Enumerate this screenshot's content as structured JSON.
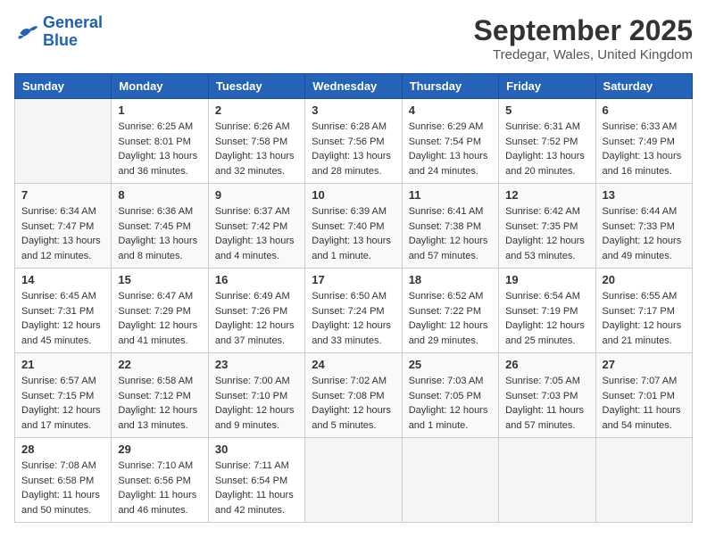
{
  "logo": {
    "line1": "General",
    "line2": "Blue"
  },
  "title": "September 2025",
  "location": "Tredegar, Wales, United Kingdom",
  "days_of_week": [
    "Sunday",
    "Monday",
    "Tuesday",
    "Wednesday",
    "Thursday",
    "Friday",
    "Saturday"
  ],
  "weeks": [
    [
      {
        "num": "",
        "sunrise": "",
        "sunset": "",
        "daylight": ""
      },
      {
        "num": "1",
        "sunrise": "Sunrise: 6:25 AM",
        "sunset": "Sunset: 8:01 PM",
        "daylight": "Daylight: 13 hours and 36 minutes."
      },
      {
        "num": "2",
        "sunrise": "Sunrise: 6:26 AM",
        "sunset": "Sunset: 7:58 PM",
        "daylight": "Daylight: 13 hours and 32 minutes."
      },
      {
        "num": "3",
        "sunrise": "Sunrise: 6:28 AM",
        "sunset": "Sunset: 7:56 PM",
        "daylight": "Daylight: 13 hours and 28 minutes."
      },
      {
        "num": "4",
        "sunrise": "Sunrise: 6:29 AM",
        "sunset": "Sunset: 7:54 PM",
        "daylight": "Daylight: 13 hours and 24 minutes."
      },
      {
        "num": "5",
        "sunrise": "Sunrise: 6:31 AM",
        "sunset": "Sunset: 7:52 PM",
        "daylight": "Daylight: 13 hours and 20 minutes."
      },
      {
        "num": "6",
        "sunrise": "Sunrise: 6:33 AM",
        "sunset": "Sunset: 7:49 PM",
        "daylight": "Daylight: 13 hours and 16 minutes."
      }
    ],
    [
      {
        "num": "7",
        "sunrise": "Sunrise: 6:34 AM",
        "sunset": "Sunset: 7:47 PM",
        "daylight": "Daylight: 13 hours and 12 minutes."
      },
      {
        "num": "8",
        "sunrise": "Sunrise: 6:36 AM",
        "sunset": "Sunset: 7:45 PM",
        "daylight": "Daylight: 13 hours and 8 minutes."
      },
      {
        "num": "9",
        "sunrise": "Sunrise: 6:37 AM",
        "sunset": "Sunset: 7:42 PM",
        "daylight": "Daylight: 13 hours and 4 minutes."
      },
      {
        "num": "10",
        "sunrise": "Sunrise: 6:39 AM",
        "sunset": "Sunset: 7:40 PM",
        "daylight": "Daylight: 13 hours and 1 minute."
      },
      {
        "num": "11",
        "sunrise": "Sunrise: 6:41 AM",
        "sunset": "Sunset: 7:38 PM",
        "daylight": "Daylight: 12 hours and 57 minutes."
      },
      {
        "num": "12",
        "sunrise": "Sunrise: 6:42 AM",
        "sunset": "Sunset: 7:35 PM",
        "daylight": "Daylight: 12 hours and 53 minutes."
      },
      {
        "num": "13",
        "sunrise": "Sunrise: 6:44 AM",
        "sunset": "Sunset: 7:33 PM",
        "daylight": "Daylight: 12 hours and 49 minutes."
      }
    ],
    [
      {
        "num": "14",
        "sunrise": "Sunrise: 6:45 AM",
        "sunset": "Sunset: 7:31 PM",
        "daylight": "Daylight: 12 hours and 45 minutes."
      },
      {
        "num": "15",
        "sunrise": "Sunrise: 6:47 AM",
        "sunset": "Sunset: 7:29 PM",
        "daylight": "Daylight: 12 hours and 41 minutes."
      },
      {
        "num": "16",
        "sunrise": "Sunrise: 6:49 AM",
        "sunset": "Sunset: 7:26 PM",
        "daylight": "Daylight: 12 hours and 37 minutes."
      },
      {
        "num": "17",
        "sunrise": "Sunrise: 6:50 AM",
        "sunset": "Sunset: 7:24 PM",
        "daylight": "Daylight: 12 hours and 33 minutes."
      },
      {
        "num": "18",
        "sunrise": "Sunrise: 6:52 AM",
        "sunset": "Sunset: 7:22 PM",
        "daylight": "Daylight: 12 hours and 29 minutes."
      },
      {
        "num": "19",
        "sunrise": "Sunrise: 6:54 AM",
        "sunset": "Sunset: 7:19 PM",
        "daylight": "Daylight: 12 hours and 25 minutes."
      },
      {
        "num": "20",
        "sunrise": "Sunrise: 6:55 AM",
        "sunset": "Sunset: 7:17 PM",
        "daylight": "Daylight: 12 hours and 21 minutes."
      }
    ],
    [
      {
        "num": "21",
        "sunrise": "Sunrise: 6:57 AM",
        "sunset": "Sunset: 7:15 PM",
        "daylight": "Daylight: 12 hours and 17 minutes."
      },
      {
        "num": "22",
        "sunrise": "Sunrise: 6:58 AM",
        "sunset": "Sunset: 7:12 PM",
        "daylight": "Daylight: 12 hours and 13 minutes."
      },
      {
        "num": "23",
        "sunrise": "Sunrise: 7:00 AM",
        "sunset": "Sunset: 7:10 PM",
        "daylight": "Daylight: 12 hours and 9 minutes."
      },
      {
        "num": "24",
        "sunrise": "Sunrise: 7:02 AM",
        "sunset": "Sunset: 7:08 PM",
        "daylight": "Daylight: 12 hours and 5 minutes."
      },
      {
        "num": "25",
        "sunrise": "Sunrise: 7:03 AM",
        "sunset": "Sunset: 7:05 PM",
        "daylight": "Daylight: 12 hours and 1 minute."
      },
      {
        "num": "26",
        "sunrise": "Sunrise: 7:05 AM",
        "sunset": "Sunset: 7:03 PM",
        "daylight": "Daylight: 11 hours and 57 minutes."
      },
      {
        "num": "27",
        "sunrise": "Sunrise: 7:07 AM",
        "sunset": "Sunset: 7:01 PM",
        "daylight": "Daylight: 11 hours and 54 minutes."
      }
    ],
    [
      {
        "num": "28",
        "sunrise": "Sunrise: 7:08 AM",
        "sunset": "Sunset: 6:58 PM",
        "daylight": "Daylight: 11 hours and 50 minutes."
      },
      {
        "num": "29",
        "sunrise": "Sunrise: 7:10 AM",
        "sunset": "Sunset: 6:56 PM",
        "daylight": "Daylight: 11 hours and 46 minutes."
      },
      {
        "num": "30",
        "sunrise": "Sunrise: 7:11 AM",
        "sunset": "Sunset: 6:54 PM",
        "daylight": "Daylight: 11 hours and 42 minutes."
      },
      {
        "num": "",
        "sunrise": "",
        "sunset": "",
        "daylight": ""
      },
      {
        "num": "",
        "sunrise": "",
        "sunset": "",
        "daylight": ""
      },
      {
        "num": "",
        "sunrise": "",
        "sunset": "",
        "daylight": ""
      },
      {
        "num": "",
        "sunrise": "",
        "sunset": "",
        "daylight": ""
      }
    ]
  ]
}
